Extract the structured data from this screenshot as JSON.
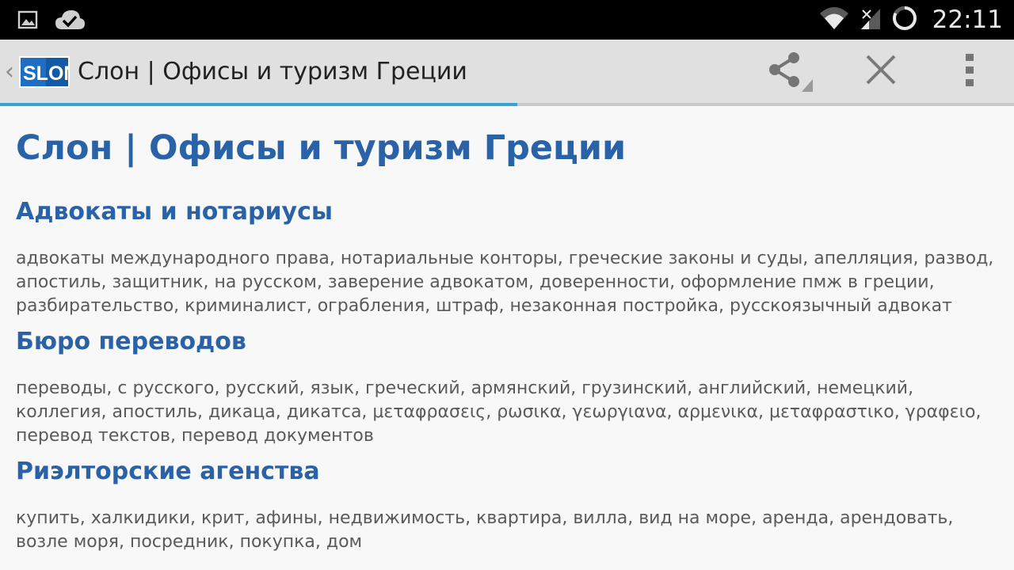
{
  "status_bar": {
    "time": "22:11",
    "icons": [
      "gallery-icon",
      "cloud-check-icon",
      "wifi-icon",
      "signal-icon",
      "sync-icon"
    ]
  },
  "action_bar": {
    "logo_text": "SLON",
    "title": "Слон | Офисы и туризм Греции",
    "icons": [
      "back-chevron-icon",
      "share-icon",
      "close-icon",
      "overflow-menu-icon"
    ]
  },
  "progress": {
    "value": 0.51,
    "color": "#33a3d6"
  },
  "page": {
    "title": "Слон | Офисы и туризм Греции",
    "sections": [
      {
        "heading": "Адвокаты и нотариусы",
        "text": "адвокаты международного права, нотариальные конторы, греческие законы и суды, апелляция, развод, апостиль, защитник, на русском, заверение адвокатом, доверенности, оформление пмж в греции, разбирательство, криминалист, ограбления, штраф, незаконная постройка, русскоязычный адвокат"
      },
      {
        "heading": "Бюро переводов",
        "text": "переводы, с русского, русский, язык, греческий, армянский, грузинский, английский, немецкий, коллегия, апостиль, дикаца, дикатса, μεταφρασεις, ρωσικα, γεωργιανα, αρμενικα, μεταφραστικο, γραφειο, перевод текстов, перевод документов"
      },
      {
        "heading": "Риэлторские агенства",
        "text": "купить, халкидики, крит, афины, недвижимость, квартира, вилла, вид на море, аренда, арендовать, возле моря, посредник, покупка, дом"
      }
    ]
  },
  "colors": {
    "heading": "#2a62a8",
    "body_text": "#5a5a5a",
    "action_bar_bg": "#e0e0e0",
    "status_bar_bg": "#000000"
  }
}
